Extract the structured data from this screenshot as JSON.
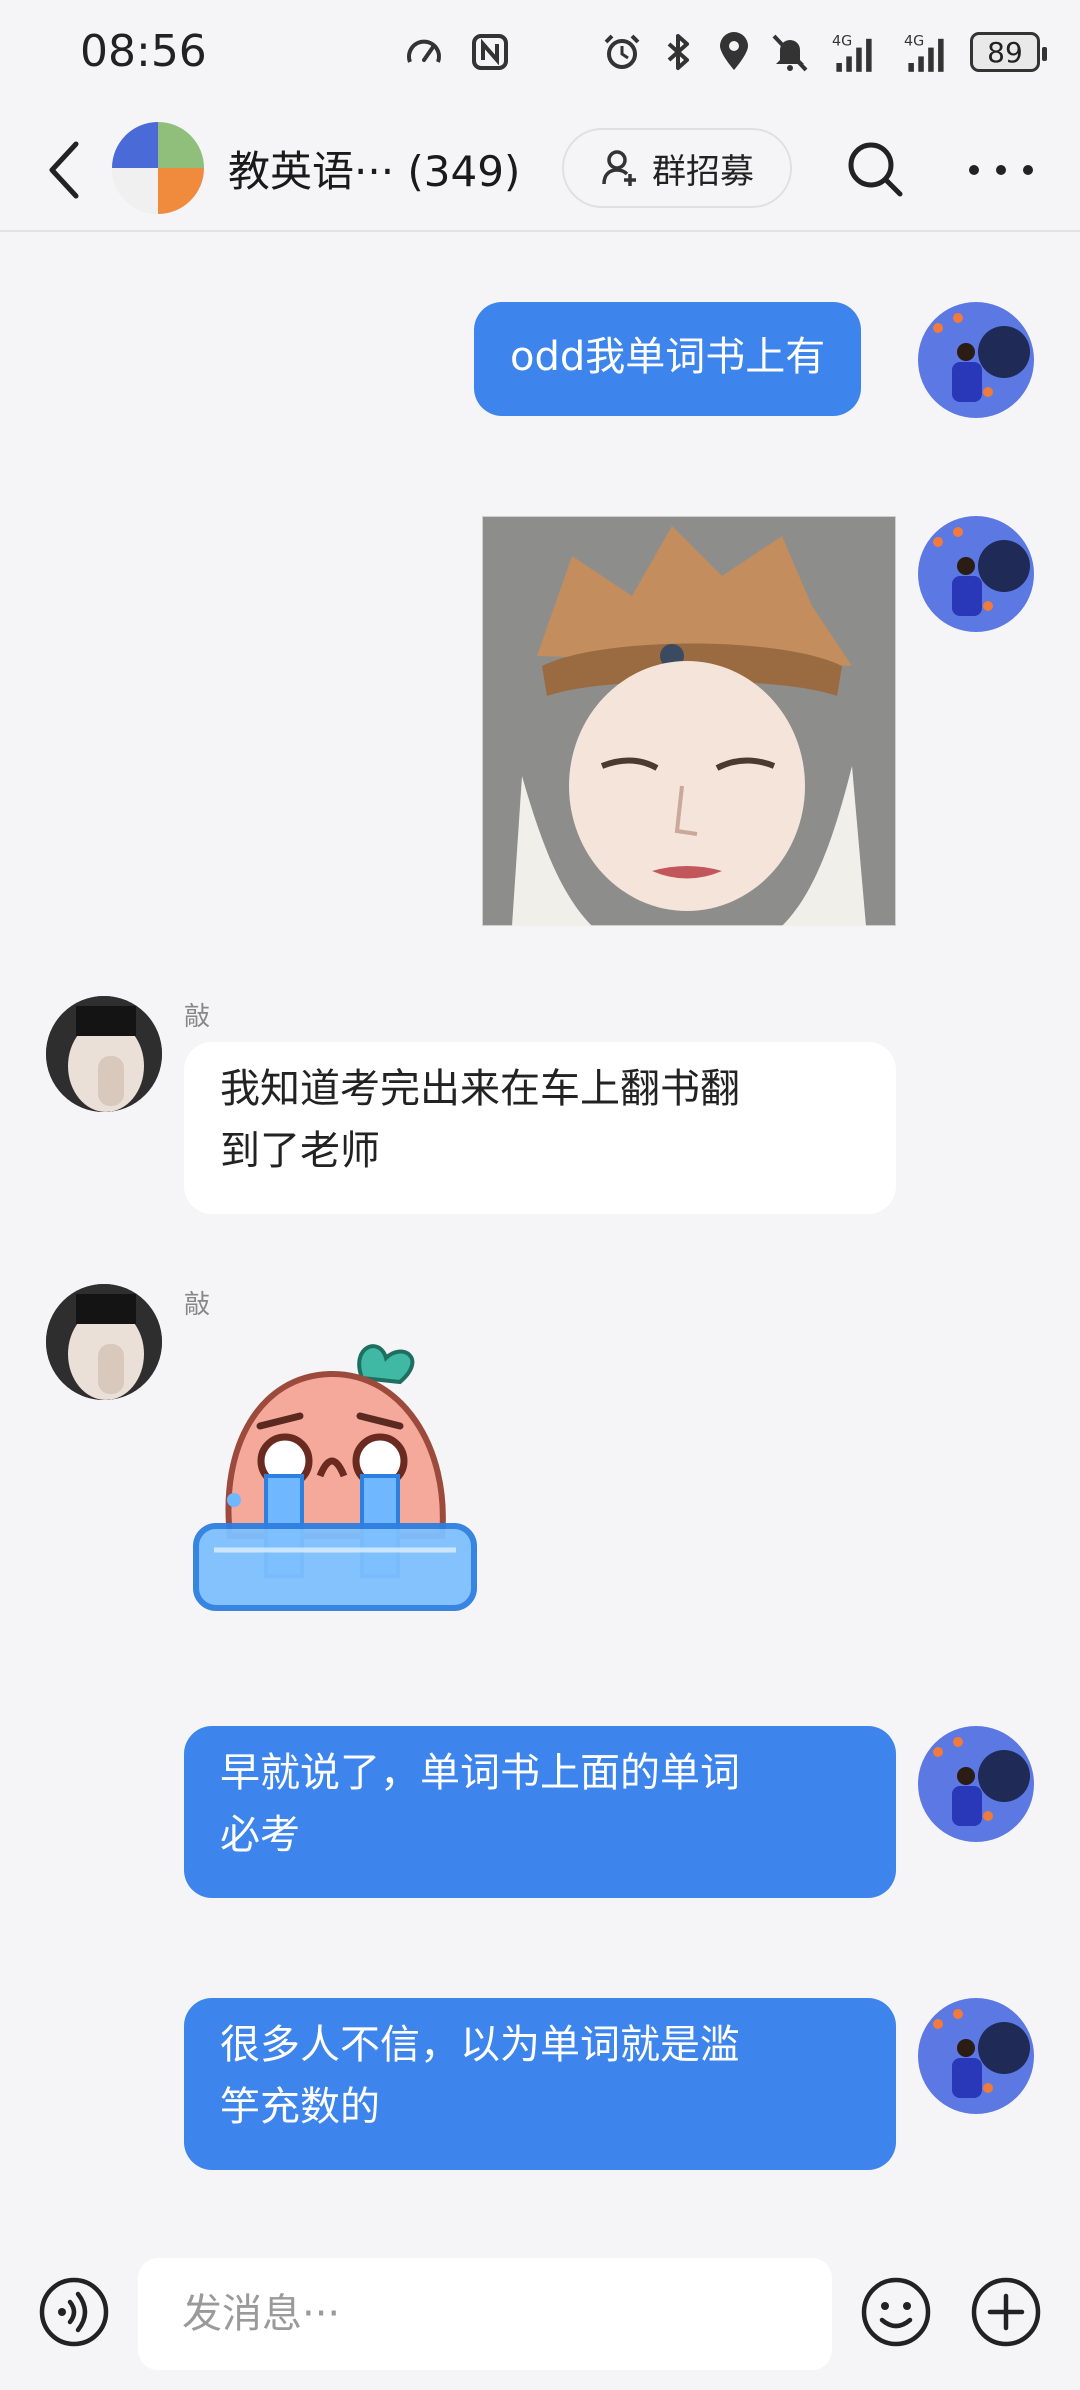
{
  "status_bar": {
    "time": "08:56",
    "battery": "89",
    "icons": [
      "speedometer-icon",
      "nfc-icon",
      "alarm-icon",
      "bluetooth-icon",
      "location-icon",
      "mute-icon",
      "signal-4g-icon",
      "signal-4g-icon",
      "battery-icon"
    ]
  },
  "header": {
    "title": "教英语··· (349)",
    "recruit_label": "群招募",
    "colors": {
      "divider": "#e3e3e6"
    }
  },
  "messages": [
    {
      "sender": "me",
      "type": "text",
      "text": "odd我单词书上有"
    },
    {
      "sender": "me",
      "type": "image",
      "image": "statue-photo"
    },
    {
      "sender": "other",
      "name": "敲",
      "type": "text",
      "lines": [
        "我知道考完出来在车上翻书翻",
        "到了老师"
      ]
    },
    {
      "sender": "other",
      "name": "敲",
      "type": "sticker",
      "sticker": "crying-sticker"
    },
    {
      "sender": "me",
      "type": "text",
      "lines": [
        "早就说了，单词书上面的单词",
        "必考"
      ]
    },
    {
      "sender": "me",
      "type": "text",
      "lines": [
        "很多人不信，以为单词就是滥",
        "竽充数的"
      ]
    }
  ],
  "input": {
    "placeholder": "发消息···",
    "value": ""
  },
  "colors": {
    "my_bubble": "#3d85ec",
    "other_bubble": "#ffffff",
    "background": "#f5f5f7"
  }
}
